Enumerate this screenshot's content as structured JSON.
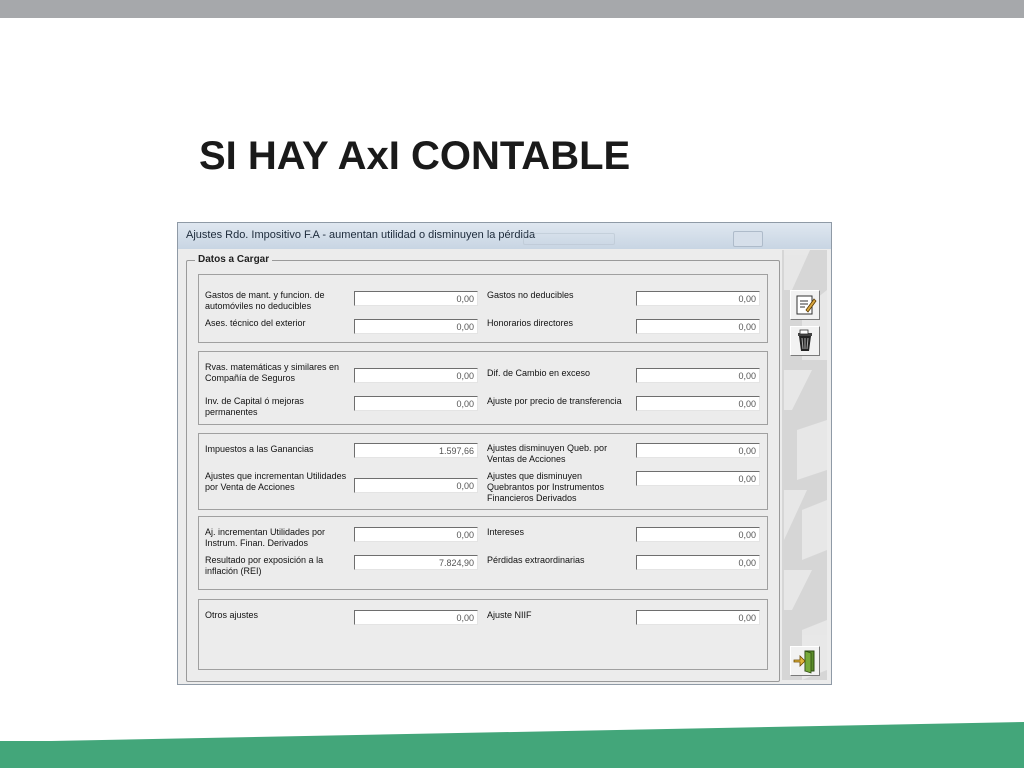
{
  "slide": {
    "title": "SI HAY AxI CONTABLE"
  },
  "window": {
    "title": "Ajustes Rdo. Impositivo F.A - aumentan utilidad o disminuyen la pérdida"
  },
  "form": {
    "legend": "Datos a Cargar",
    "groups": [
      {
        "rows": [
          {
            "left_label": "Gastos de mant. y funcion. de\nautomóviles no deducibles",
            "left_value": "0,00",
            "right_label": "Gastos no deducibles",
            "right_value": "0,00"
          },
          {
            "left_label": "Ases. técnico del exterior",
            "left_value": "0,00",
            "right_label": "Honorarios directores",
            "right_value": "0,00"
          }
        ]
      },
      {
        "rows": [
          {
            "left_label": "Rvas. matemáticas y similares en\nCompañía de Seguros",
            "left_value": "0,00",
            "right_label": "Dif. de Cambio en exceso",
            "right_value": "0,00"
          },
          {
            "left_label": "Inv. de Capital ó mejoras\npermanentes",
            "left_value": "0,00",
            "right_label": "Ajuste por precio de transferencia",
            "right_value": "0,00"
          }
        ]
      },
      {
        "rows": [
          {
            "left_label": "Impuestos a las Ganancias",
            "left_value": "1.597,66",
            "right_label": "Ajustes disminuyen Queb. por\nVentas de Acciones",
            "right_value": "0,00"
          },
          {
            "left_label": "Ajustes que incrementan Utilidades\npor Venta de Acciones",
            "left_value": "0,00",
            "right_label": "Ajustes que disminuyen\nQuebrantos por Instrumentos\nFinancieros Derivados",
            "right_value": "0,00"
          }
        ]
      },
      {
        "rows": [
          {
            "left_label": "Aj. incrementan Utilidades por\nInstrum. Finan. Derivados",
            "left_value": "0,00",
            "right_label": "Intereses",
            "right_value": "0,00"
          },
          {
            "left_label": "Resultado por exposición a la\ninflación (REI)",
            "left_value": "7.824,90",
            "right_label": "Pérdidas extraordinarias",
            "right_value": "0,00"
          }
        ]
      },
      {
        "rows": [
          {
            "left_label": "Otros ajustes",
            "left_value": "0,00",
            "right_label": "Ajuste NIIF",
            "right_value": "0,00"
          }
        ]
      }
    ]
  },
  "toolbar": {
    "buttons": [
      {
        "icon": "edit-document-icon"
      },
      {
        "icon": "trash-bin-icon"
      },
      {
        "icon": "exit-door-icon"
      }
    ]
  },
  "colors": {
    "accent_green": "#43a67a",
    "top_bar_gray": "#a6a8ab",
    "window_face": "#ececec"
  }
}
